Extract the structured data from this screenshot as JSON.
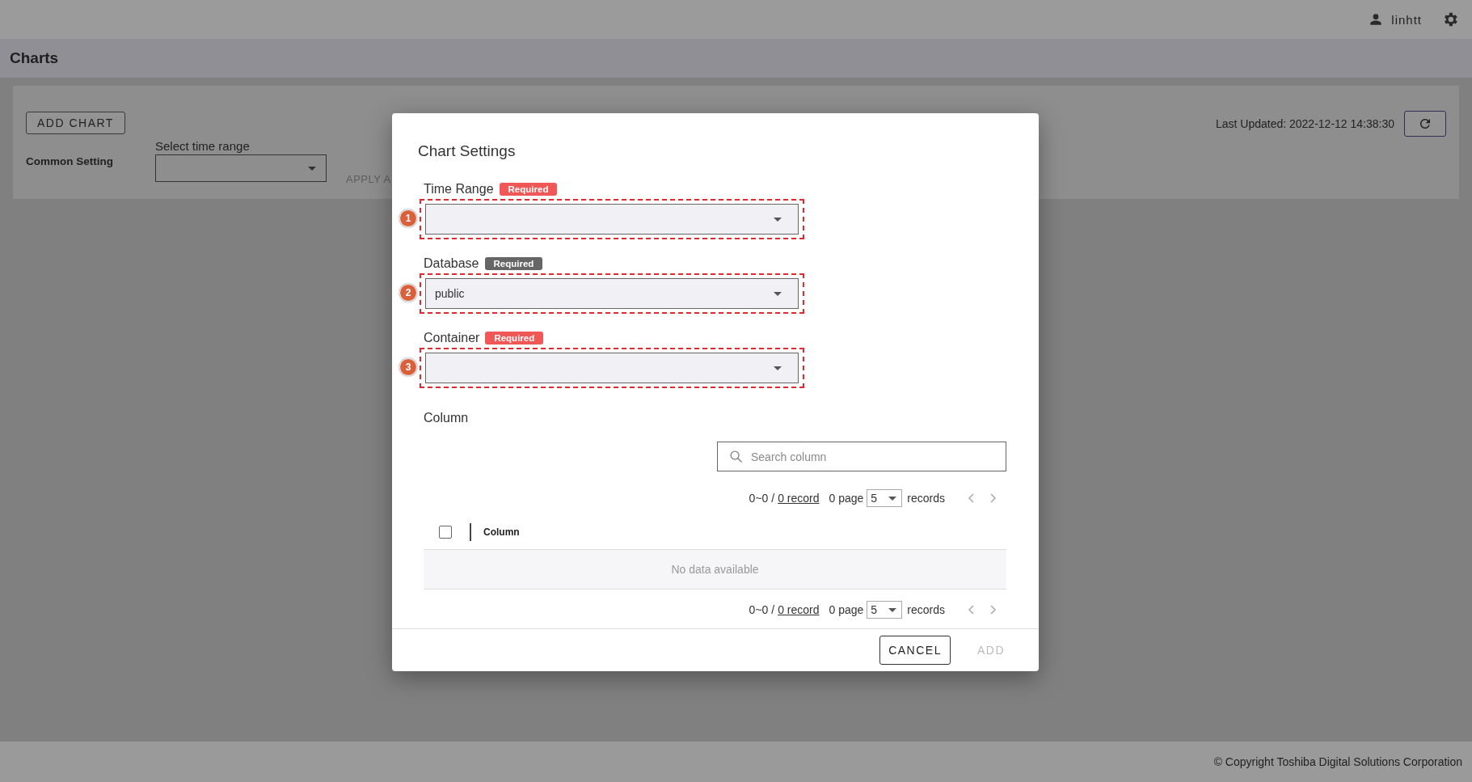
{
  "header": {
    "user": "linhtt"
  },
  "page": {
    "title": "Charts"
  },
  "toolbar": {
    "add_chart": "ADD CHART",
    "common_setting": "Common Setting",
    "time_range_label": "Select time range",
    "apply": "APPLY A",
    "last_updated": "Last Updated: 2022-12-12 14:38:30"
  },
  "dialog": {
    "title": "Chart Settings",
    "fields": [
      {
        "marker": "1",
        "label": "Time Range",
        "badge": "Required",
        "satisfied": false
      },
      {
        "marker": "2",
        "label": "Database",
        "badge": "Required",
        "satisfied": true,
        "value": "public"
      },
      {
        "marker": "3",
        "label": "Container",
        "badge": "Required",
        "satisfied": false
      }
    ],
    "column": {
      "label": "Column",
      "search": {
        "placeholder": "Search column"
      },
      "pager_top": {
        "range": "0~0 /",
        "total": "0 record",
        "pages": "0 page",
        "page_size": "5",
        "unit": "records"
      },
      "table": {
        "select_all_checked": false,
        "columns": [
          "Column"
        ],
        "empty": "No data available"
      },
      "pager_bottom": {
        "range": "0~0 /",
        "total": "0 record",
        "pages": "0 page",
        "page_size": "5",
        "unit": "records"
      }
    },
    "buttons": [
      {
        "label": "CANCEL",
        "disabled": false
      },
      {
        "label": "ADD",
        "disabled": true
      }
    ]
  },
  "footer": {
    "copyright": "© Copyright Toshiba Digital Solutions Corporation"
  }
}
